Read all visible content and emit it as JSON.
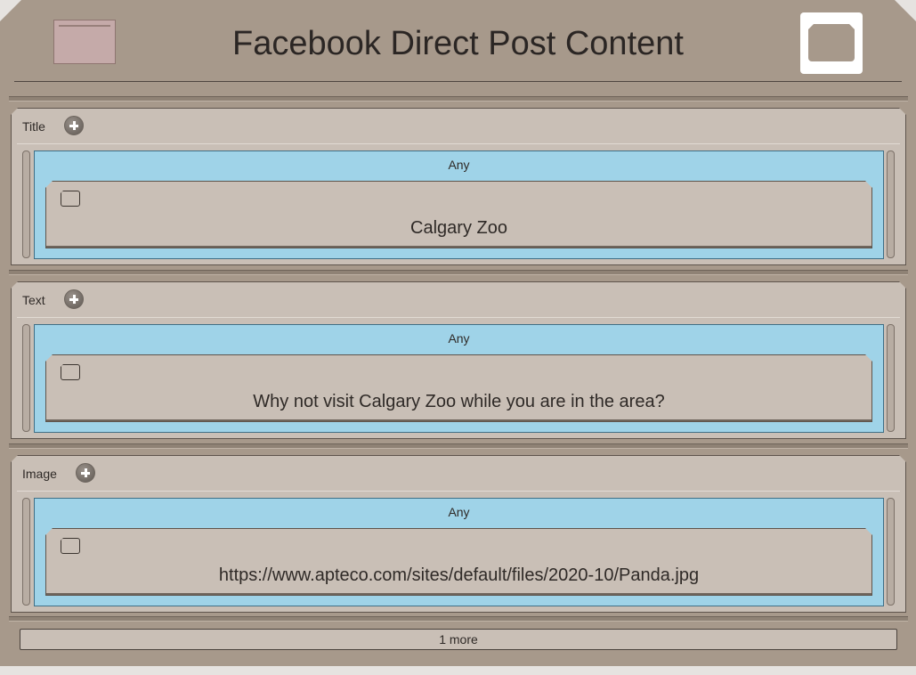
{
  "header": {
    "title": "Facebook Direct Post Content"
  },
  "sections": [
    {
      "label": "Title",
      "any_label": "Any",
      "value": "Calgary Zoo"
    },
    {
      "label": "Text",
      "any_label": "Any",
      "value": "Why not visit Calgary Zoo while you are in the area?"
    },
    {
      "label": "Image",
      "any_label": "Any",
      "value": "https://www.apteco.com/sites/default/files/2020-10/Panda.jpg"
    }
  ],
  "footer": {
    "more_label": "1 more"
  },
  "colors": {
    "background": "#a7998b",
    "panel": "#c9bfb6",
    "accent_blue": "#9fd3e8"
  }
}
